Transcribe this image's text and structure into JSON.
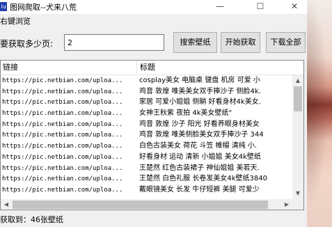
{
  "window": {
    "icon_text": "iu",
    "title": "图网爬取--犬来八荒",
    "minimize_glyph": "—",
    "maximize_glyph": "☐",
    "close_glyph": "✕"
  },
  "menu": {
    "items": [
      "右键浏览"
    ]
  },
  "toolbar": {
    "count_label": "要获取多少页:",
    "count_value": "2",
    "search_button": "搜索壁纸",
    "start_button": "开始获取",
    "download_all_button": "下载全部"
  },
  "table": {
    "columns": [
      "链接",
      "标题"
    ],
    "rows": [
      [
        "https://pic.netbian.com/uploa...",
        "cosplay美女 电脑桌 键盘 机房 可爱 小"
      ],
      [
        "https://pic.netbian.com/uploa...",
        "鸡音 敦煌 唯美美女双手捧沙子 侧脸4k."
      ],
      [
        "https://pic.netbian.com/uploa...",
        "家居 可爱小姐姐 侧躺 好看身材4k美女."
      ],
      [
        "https://pic.netbian.com/uploa...",
        "女神王秋紫 夜拍 4k美女壁纸\""
      ],
      [
        "https://pic.netbian.com/uploa...",
        "鸡音 敦煌 沙子 阳光 好看养眼身材美女"
      ],
      [
        "https://pic.netbian.com/uploa...",
        "鸡音 敦煌 唯美侧脸美女双手捧沙子 344"
      ],
      [
        "https://pic.netbian.com/uploa...",
        "白色古装美女 荷花 斗笠 帷帽 清纯 小."
      ],
      [
        "https://pic.netbian.com/uploa...",
        "好看身材 运动 清新 小姐姐 美女4k壁纸"
      ],
      [
        "https://pic.netbian.com/uploa...",
        "王楚然 红色古装裙子 神仙姐姐 美若天."
      ],
      [
        "https://pic.netbian.com/uploa...",
        "王楚然 白色礼服 长卷发美女4k壁纸3840"
      ],
      [
        "https://pic.netbian.com/uploa...",
        "戴眼镜美女 长发 牛仔短裤 美腿 可爱少"
      ]
    ]
  },
  "scrollbars": {
    "up": "▲",
    "down": "▼",
    "left": "◀",
    "right": "▶"
  },
  "status": {
    "text": "获取到：46张壁纸"
  },
  "background": {
    "photo": "background-photo"
  }
}
